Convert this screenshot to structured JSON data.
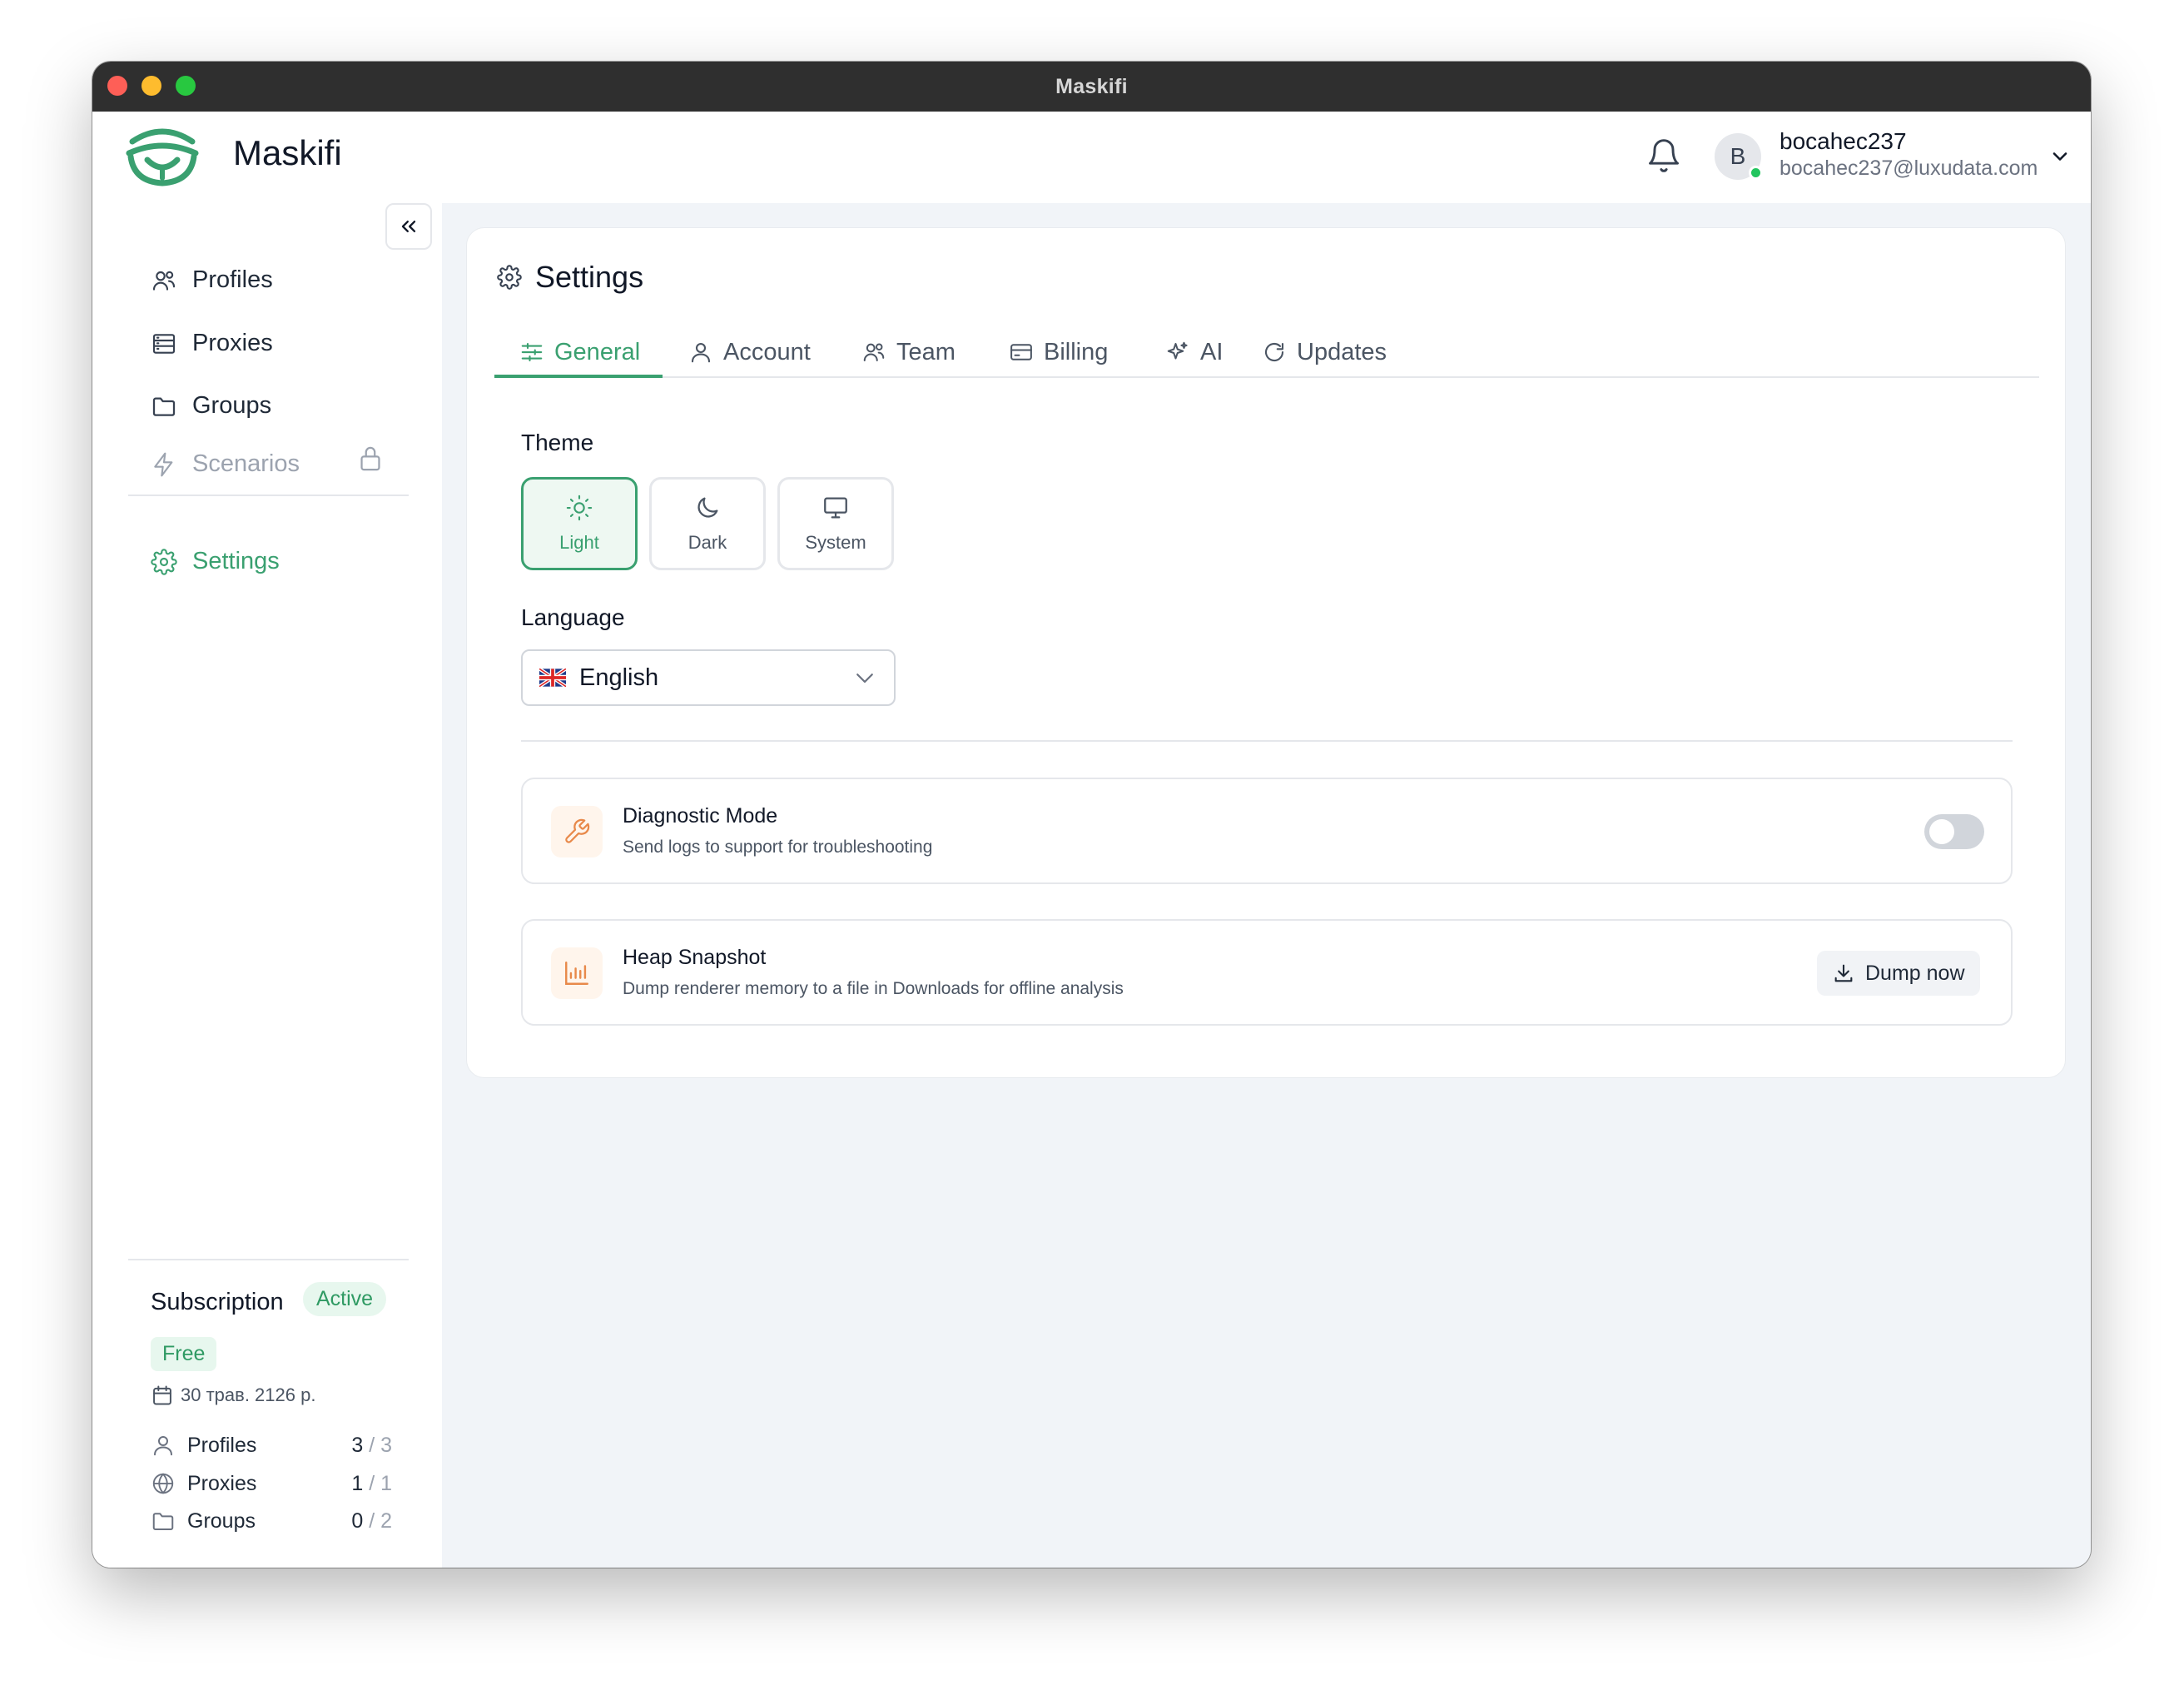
{
  "window": {
    "title": "Maskifi"
  },
  "header": {
    "app_name": "Maskifi",
    "user": {
      "initial": "B",
      "name": "bocahec237",
      "email": "bocahec237@luxudata.com"
    }
  },
  "sidebar": {
    "items": [
      {
        "label": "Profiles",
        "icon": "users-icon"
      },
      {
        "label": "Proxies",
        "icon": "server-icon"
      },
      {
        "label": "Groups",
        "icon": "folder-icon"
      },
      {
        "label": "Scenarios",
        "icon": "bolt-icon",
        "locked": true
      },
      {
        "label": "Settings",
        "icon": "gear-icon",
        "active": true
      }
    ],
    "subscription": {
      "title": "Subscription",
      "status": "Active",
      "plan": "Free",
      "date": "30 трав. 2126 р.",
      "usage": [
        {
          "label": "Profiles",
          "used": "3",
          "limit": "/ 3"
        },
        {
          "label": "Proxies",
          "used": "1",
          "limit": "/ 1"
        },
        {
          "label": "Groups",
          "used": "0",
          "limit": "/ 2"
        }
      ]
    }
  },
  "settings": {
    "title": "Settings",
    "tabs": [
      {
        "label": "General",
        "active": true
      },
      {
        "label": "Account"
      },
      {
        "label": "Team"
      },
      {
        "label": "Billing"
      },
      {
        "label": "AI"
      },
      {
        "label": "Updates"
      }
    ],
    "theme": {
      "label": "Theme",
      "options": [
        "Light",
        "Dark",
        "System"
      ],
      "selected": "Light"
    },
    "language": {
      "label": "Language",
      "value": "English"
    },
    "diagnostic": {
      "title": "Diagnostic Mode",
      "description": "Send logs to support for troubleshooting",
      "enabled": false
    },
    "heap": {
      "title": "Heap Snapshot",
      "description": "Dump renderer memory to a file in Downloads for offline analysis",
      "button": "Dump now"
    }
  },
  "colors": {
    "accent": "#3aa070",
    "orange": "#e8894a"
  }
}
